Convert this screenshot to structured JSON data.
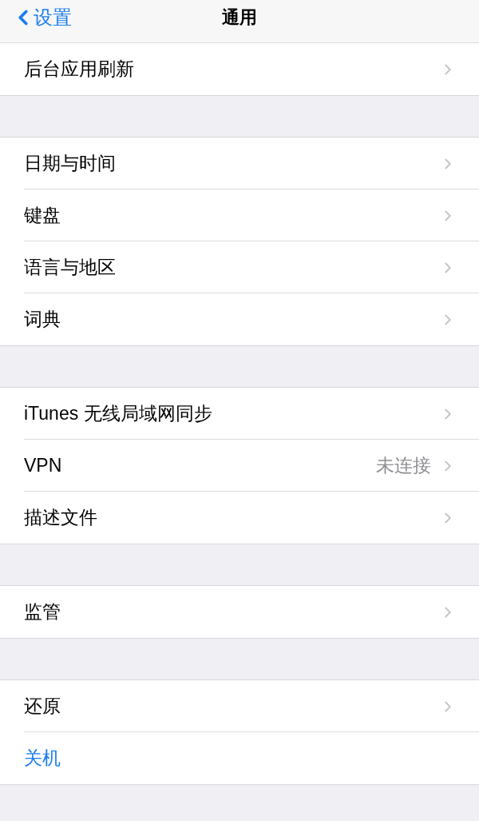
{
  "nav": {
    "back_label": "设置",
    "title": "通用"
  },
  "sections": [
    {
      "rows": [
        {
          "label": "后台应用刷新",
          "kind": "link"
        }
      ]
    },
    {
      "rows": [
        {
          "label": "日期与时间",
          "kind": "link"
        },
        {
          "label": "键盘",
          "kind": "link"
        },
        {
          "label": "语言与地区",
          "kind": "link"
        },
        {
          "label": "词典",
          "kind": "link"
        }
      ]
    },
    {
      "rows": [
        {
          "label": "iTunes 无线局域网同步",
          "kind": "link"
        },
        {
          "label": "VPN",
          "value": "未连接",
          "kind": "link"
        },
        {
          "label": "描述文件",
          "kind": "link"
        }
      ]
    },
    {
      "rows": [
        {
          "label": "监管",
          "kind": "link"
        }
      ]
    },
    {
      "rows": [
        {
          "label": "还原",
          "kind": "link"
        },
        {
          "label": "关机",
          "kind": "action"
        }
      ]
    }
  ]
}
